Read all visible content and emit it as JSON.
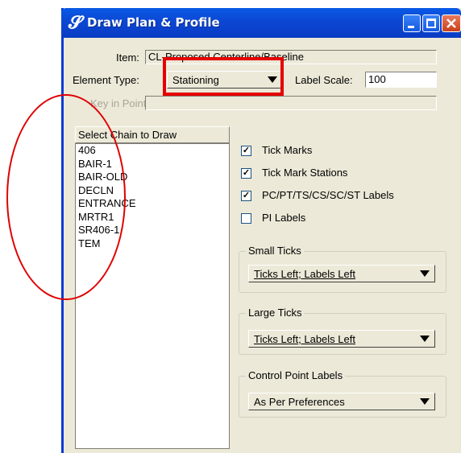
{
  "window": {
    "title": "Draw Plan & Profile",
    "title_icon": "ribbon-s-icon"
  },
  "form": {
    "item_label": "Item:",
    "item_value": "CL-Proposed Centerline/Baseline",
    "element_type_label": "Element Type:",
    "element_type_value": "Stationing",
    "label_scale_label": "Label Scale:",
    "label_scale_value": "100",
    "keyin_label": "Key in Points:",
    "keyin_value": ""
  },
  "chain_list": {
    "header": "Select Chain to Draw",
    "items": [
      "406",
      "BAIR-1",
      "BAIR-OLD",
      "DECLN",
      "ENTRANCE",
      "MRTR1",
      "SR406-1",
      "TEM"
    ]
  },
  "options": [
    {
      "label": "Tick Marks",
      "checked": true
    },
    {
      "label": "Tick Mark Stations",
      "checked": true
    },
    {
      "label": "PC/PT/TS/CS/SC/ST Labels",
      "checked": true
    },
    {
      "label": "PI Labels",
      "checked": false
    }
  ],
  "groups": {
    "small_ticks": {
      "title": "Small Ticks",
      "value": "Ticks Left; Labels Left"
    },
    "large_ticks": {
      "title": "Large Ticks",
      "value": "Ticks Left; Labels Left"
    },
    "control_point": {
      "title": "Control Point Labels",
      "value": "As Per Preferences"
    }
  },
  "colors": {
    "annotation": "#e60000",
    "titlebar": "#0b47d3",
    "dialog_bg": "#ece9d8"
  }
}
